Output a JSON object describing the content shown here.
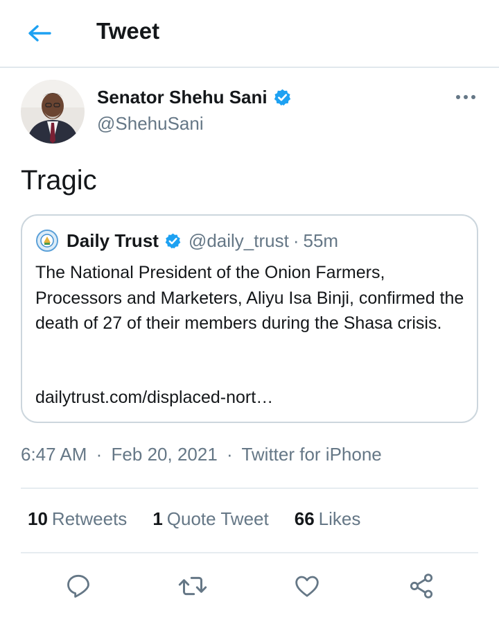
{
  "header": {
    "title": "Tweet",
    "back_icon": "arrow-left-icon",
    "accent": "#1da1f2"
  },
  "tweet": {
    "author": {
      "name": "Senator Shehu Sani",
      "handle": "@ShehuSani",
      "verified": true
    },
    "text": "Tragic",
    "quote": {
      "name": "Daily Trust",
      "handle": "@daily_trust",
      "separator": "·",
      "time": "55m",
      "verified": true,
      "body": "The National President of the Onion Farmers, Processors and Marketers, Aliyu Isa Binji, confirmed the death of 27 of their members during the Shasa crisis.",
      "link": "dailytrust.com/displaced-nort…"
    },
    "meta": {
      "time": "6:47 AM",
      "date": "Feb 20, 2021",
      "separator": "·",
      "source": "Twitter for iPhone"
    },
    "stats": {
      "retweets_count": "10",
      "retweets_label": "Retweets",
      "quotes_count": "1",
      "quotes_label": "Quote Tweet",
      "likes_count": "66",
      "likes_label": "Likes"
    },
    "actions": [
      "reply-icon",
      "retweet-icon",
      "like-icon",
      "share-icon"
    ]
  },
  "colors": {
    "text": "#14171a",
    "secondary": "#657786",
    "border": "#ccd6dd",
    "verified": "#1da1f2"
  }
}
